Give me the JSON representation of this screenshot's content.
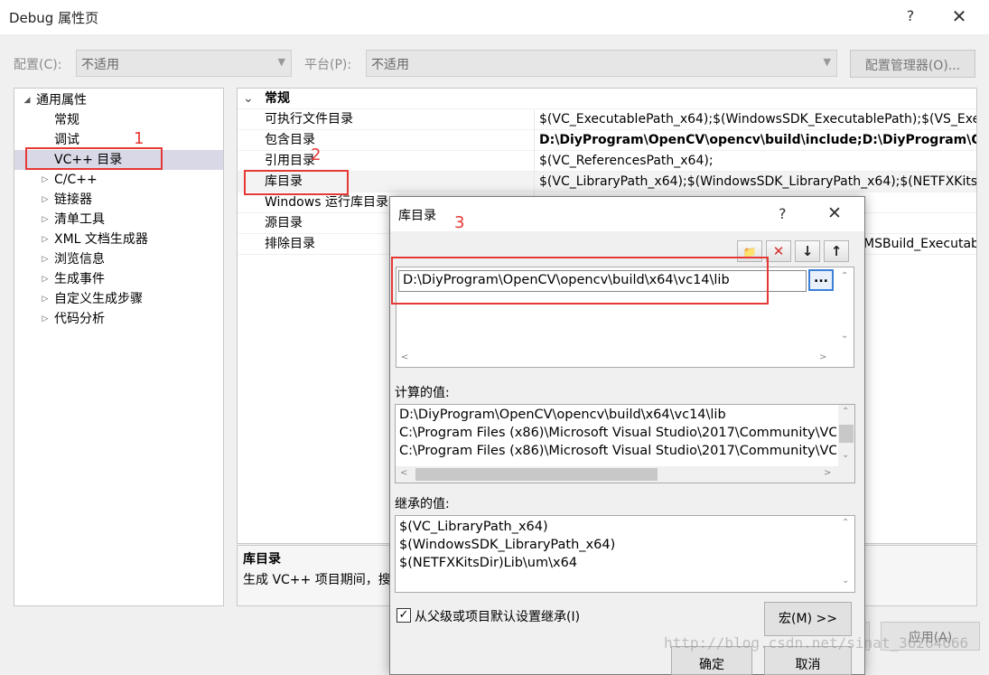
{
  "window": {
    "title": "Debug 属性页",
    "help": "?",
    "close": "✕"
  },
  "config_row": {
    "config_label": "配置(C):",
    "config_value": "不适用",
    "platform_label": "平台(P):",
    "platform_value": "不适用",
    "config_manager": "配置管理器(O)..."
  },
  "tree": {
    "items": [
      {
        "label": "通用属性",
        "twisty": "◢"
      },
      {
        "label": "常规"
      },
      {
        "label": "调试"
      },
      {
        "label": "VC++ 目录"
      },
      {
        "label": "C/C++",
        "twisty": "▷"
      },
      {
        "label": "链接器",
        "twisty": "▷"
      },
      {
        "label": "清单工具",
        "twisty": "▷"
      },
      {
        "label": "XML 文档生成器",
        "twisty": "▷"
      },
      {
        "label": "浏览信息",
        "twisty": "▷"
      },
      {
        "label": "生成事件",
        "twisty": "▷"
      },
      {
        "label": "自定义生成步骤",
        "twisty": "▷"
      },
      {
        "label": "代码分析",
        "twisty": "▷"
      }
    ]
  },
  "grid": {
    "category": "常规",
    "collapse_glyph": "⌄",
    "rows": [
      {
        "name": "可执行文件目录",
        "value": "$(VC_ExecutablePath_x64);$(WindowsSDK_ExecutablePath);$(VS_ExecutablePath)"
      },
      {
        "name": "包含目录",
        "value": "D:\\DiyProgram\\OpenCV\\opencv\\build\\include;D:\\DiyProgram\\OpenCV"
      },
      {
        "name": "引用目录",
        "value": "$(VC_ReferencesPath_x64);"
      },
      {
        "name": "库目录",
        "value": "$(VC_LibraryPath_x64);$(WindowsSDK_LibraryPath_x64);$(NETFXKitsDir)"
      },
      {
        "name": "Windows 运行库目录",
        "value": ""
      },
      {
        "name": "源目录",
        "value": ""
      },
      {
        "name": "排除目录",
        "value": "MSBuild_ExecutablePath"
      }
    ]
  },
  "description": {
    "title": "库目录",
    "text": "生成 VC++ 项目期间，搜"
  },
  "annotations": {
    "n1": "1",
    "n2": "2",
    "n3": "3"
  },
  "dialog": {
    "title": "库目录",
    "help": "?",
    "close": "✕",
    "toolbar": {
      "new_line": "📁",
      "delete": "✕",
      "move_down": "↓",
      "move_up": "↑"
    },
    "edit_value": "D:\\DiyProgram\\OpenCV\\opencv\\build\\x64\\vc14\\lib",
    "browse_label": "...",
    "evaluated_label": "计算的值:",
    "evaluated_values": [
      "D:\\DiyProgram\\OpenCV\\opencv\\build\\x64\\vc14\\lib",
      "C:\\Program Files (x86)\\Microsoft Visual Studio\\2017\\Community\\VC",
      "C:\\Program Files (x86)\\Microsoft Visual Studio\\2017\\Community\\VC"
    ],
    "inherited_label": "继承的值:",
    "inherited_values": [
      "$(VC_LibraryPath_x64)",
      "$(WindowsSDK_LibraryPath_x64)",
      "$(NETFXKitsDir)Lib\\um\\x64"
    ],
    "inherit_checkbox_label": "从父级或项目默认设置继承(I)",
    "inherit_checked": true,
    "macro_button": "宏(M) >>",
    "ok_button": "确定",
    "cancel_button": "取消"
  },
  "apply_button": "应用(A)",
  "watermark": "http://blog.csdn.net/sinat_36264666",
  "colors": {
    "annotation": "#e53935",
    "selected_row": "#d8d8e6",
    "browse_border": "#3c7fd6"
  }
}
